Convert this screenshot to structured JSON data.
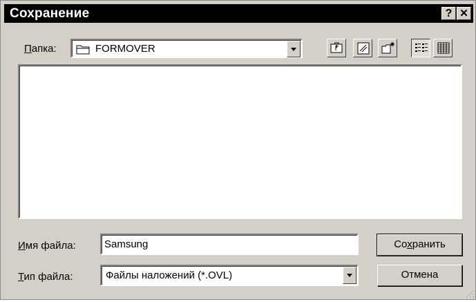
{
  "dialog": {
    "title": "Сохранение",
    "help_button": "?",
    "close_button": "✕"
  },
  "folder": {
    "label_prefix": "",
    "label_hotkey": "П",
    "label_rest": "апка:",
    "value": "FORMOVER"
  },
  "toolbar": {
    "buttons": [
      "up-one-level",
      "desktop",
      "new-folder",
      "list-view",
      "details-view"
    ]
  },
  "file_name": {
    "label_hotkey": "И",
    "label_rest": "мя файла:",
    "value": "Samsung"
  },
  "file_type": {
    "label_hotkey": "Т",
    "label_rest": "ип файла:",
    "value": "Файлы наложений (*.OVL)"
  },
  "buttons": {
    "save_prefix": "Со",
    "save_hotkey": "х",
    "save_rest": "ранить",
    "cancel": "Отмена"
  }
}
